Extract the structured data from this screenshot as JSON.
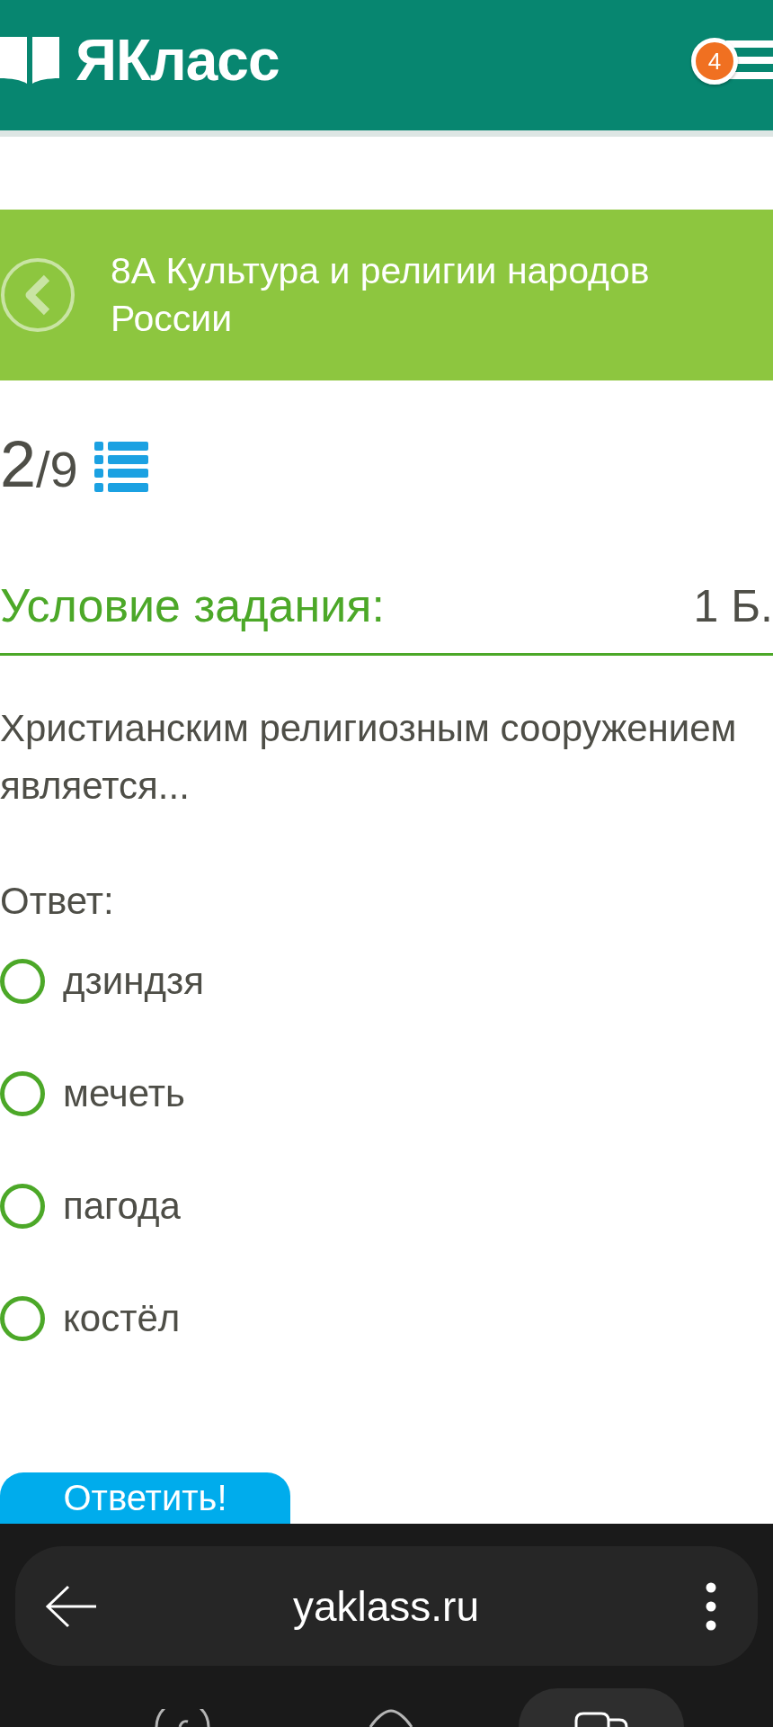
{
  "header": {
    "logo_text": "ЯКласс",
    "notification_count": "4"
  },
  "banner": {
    "title": "8А Культура и религии народов России"
  },
  "progress": {
    "current": "2",
    "total": "/9"
  },
  "task": {
    "heading": "Условие задания:",
    "points": "1 Б.",
    "question": "Христианским религиозным сооружением является...",
    "answer_label": "Ответ:"
  },
  "options": [
    {
      "label": "дзиндзя",
      "selected": false
    },
    {
      "label": "мечеть",
      "selected": false
    },
    {
      "label": "пагода",
      "selected": false
    },
    {
      "label": "костёл",
      "selected": false
    }
  ],
  "submit_button": {
    "label": "Ответить!"
  },
  "browser": {
    "url": "yaklass.ru"
  }
}
